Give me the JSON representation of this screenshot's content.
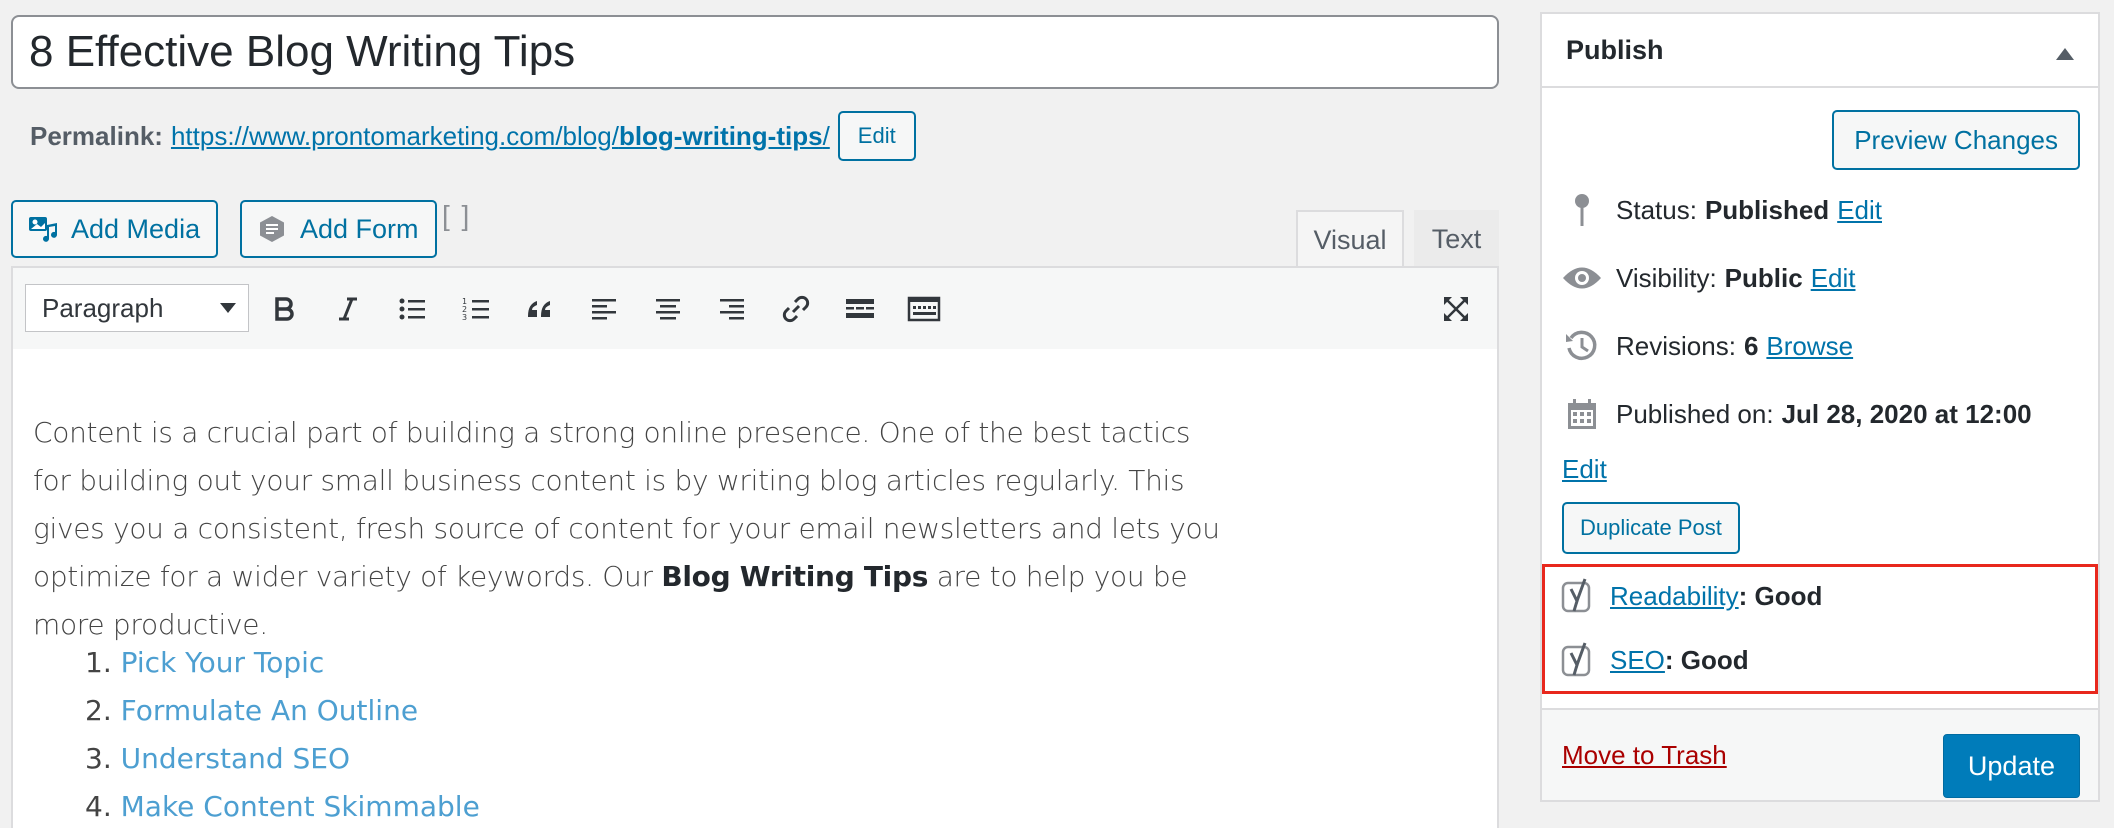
{
  "post": {
    "title": "8 Effective Blog Writing Tips"
  },
  "permalink": {
    "label": "Permalink:",
    "url_base": "https://www.prontomarketing.com/blog/",
    "url_slug": "blog-writing-tips",
    "url_suffix": "/",
    "edit_label": "Edit"
  },
  "media_buttons": {
    "add_media": "Add Media",
    "add_form": "Add Form",
    "shortcode_glyph": "[ ]"
  },
  "editor_tabs": {
    "visual": "Visual",
    "text": "Text"
  },
  "toolbar": {
    "format_select": "Paragraph"
  },
  "content": {
    "intro": "Content is a crucial part of building a strong online presence. One of the best tactics for building out your small business content is by writing blog articles regularly. This gives you a consistent, fresh source of content for your email newsletters and lets you optimize for a wider variety of keywords. Our ",
    "intro_bold": "Blog Writing Tips",
    "intro_end": " are to help you be more productive.",
    "list": [
      {
        "num": "1.",
        "text": "Pick Your Topic"
      },
      {
        "num": "2.",
        "text": "Formulate An Outline"
      },
      {
        "num": "3.",
        "text": "Understand SEO"
      },
      {
        "num": "4.",
        "text": "Make Content Skimmable"
      }
    ]
  },
  "publish": {
    "title": "Publish",
    "preview_label": "Preview Changes",
    "status_label": "Status:",
    "status_value": "Published",
    "visibility_label": "Visibility:",
    "visibility_value": "Public",
    "revisions_label": "Revisions:",
    "revisions_value": "6",
    "browse_label": "Browse",
    "published_label": "Published on:",
    "published_value": "Jul 28, 2020 at 12:00",
    "edit_label": "Edit",
    "duplicate_label": "Duplicate Post",
    "readability_label": "Readability",
    "readability_value": ": Good",
    "seo_label": "SEO",
    "seo_value": ": Good",
    "trash_label": "Move to Trash",
    "update_label": "Update"
  },
  "colors": {
    "accent": "#0073aa",
    "primary_button": "#007cba",
    "trash": "#aa0000",
    "highlight_border": "#e8281d"
  }
}
